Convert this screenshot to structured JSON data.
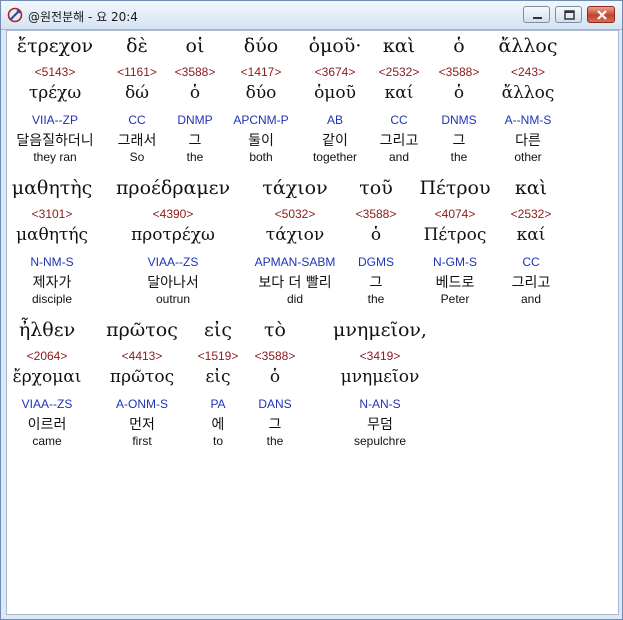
{
  "window": {
    "title": "@원전분해 - 요 20:4"
  },
  "colors": {
    "strongs": "#8b1a1a",
    "parsing": "#1f33b6",
    "text": "#111111"
  },
  "icons": {
    "app": "app-icon",
    "minimize": "minimize-icon",
    "maximize": "maximize-icon",
    "close": "close-icon"
  },
  "lines": [
    {
      "words": [
        {
          "greek": "ἔτρεχον",
          "strongs": "<5143>",
          "lemma": "τρέχω",
          "parsing": "VIIA--ZP",
          "korean": "달음질하더니",
          "english": "they ran"
        },
        {
          "greek": "δὲ",
          "strongs": "<1161>",
          "lemma": "δώ",
          "parsing": "CC",
          "korean": "그래서",
          "english": "So"
        },
        {
          "greek": "οἱ",
          "strongs": "<3588>",
          "lemma": "ὁ",
          "parsing": "DNMP",
          "korean": "그",
          "english": "the"
        },
        {
          "greek": "δύο",
          "strongs": "<1417>",
          "lemma": "δύο",
          "parsing": "APCNM-P",
          "korean": "둘이",
          "english": "both"
        },
        {
          "greek": "ὁμοῦ·",
          "strongs": "<3674>",
          "lemma": "ὁμοῦ",
          "parsing": "AB",
          "korean": "같이",
          "english": "together"
        },
        {
          "greek": "καὶ",
          "strongs": "<2532>",
          "lemma": "καί",
          "parsing": "CC",
          "korean": "그리고",
          "english": "and"
        },
        {
          "greek": "ὁ",
          "strongs": "<3588>",
          "lemma": "ὁ",
          "parsing": "DNMS",
          "korean": "그",
          "english": "the"
        },
        {
          "greek": "ἄλλος",
          "strongs": "<243>",
          "lemma": "ἄλλος",
          "parsing": "A--NM-S",
          "korean": "다른",
          "english": "other"
        }
      ]
    },
    {
      "words": [
        {
          "greek": "μαθητὴς",
          "strongs": "<3101>",
          "lemma": "μαθητής",
          "parsing": "N-NM-S",
          "korean": "제자가",
          "english": "disciple"
        },
        {
          "greek": "προέδραμεν",
          "strongs": "<4390>",
          "lemma": "προτρέχω",
          "parsing": "VIAA--ZS",
          "korean": "달아나서",
          "english": "outrun"
        },
        {
          "greek": "τάχιον",
          "strongs": "<5032>",
          "lemma": "τάχιον",
          "parsing": "APMAN-SABM",
          "korean": "보다 더 빨리",
          "english": "did"
        },
        {
          "greek": "τοῦ",
          "strongs": "<3588>",
          "lemma": "ὁ",
          "parsing": "DGMS",
          "korean": "그",
          "english": "the"
        },
        {
          "greek": "Πέτρου",
          "strongs": "<4074>",
          "lemma": "Πέτρος",
          "parsing": "N-GM-S",
          "korean": "베드로",
          "english": "Peter"
        },
        {
          "greek": "καὶ",
          "strongs": "<2532>",
          "lemma": "καί",
          "parsing": "CC",
          "korean": "그리고",
          "english": "and"
        }
      ]
    },
    {
      "words": [
        {
          "greek": "ἦλθεν",
          "strongs": "<2064>",
          "lemma": "ἔρχομαι",
          "parsing": "VIAA--ZS",
          "korean": "이르러",
          "english": "came"
        },
        {
          "greek": "πρῶτος",
          "strongs": "<4413>",
          "lemma": "πρῶτος",
          "parsing": "A-ONM-S",
          "korean": "먼저",
          "english": "first"
        },
        {
          "greek": "εἰς",
          "strongs": "<1519>",
          "lemma": "εἰς",
          "parsing": "PA",
          "korean": "에",
          "english": "to"
        },
        {
          "greek": "τὸ",
          "strongs": "<3588>",
          "lemma": "ὁ",
          "parsing": "DANS",
          "korean": "그",
          "english": "the"
        },
        {
          "greek": "μνημεῖον,",
          "strongs": "<3419>",
          "lemma": "μνημεῖον",
          "parsing": "N-AN-S",
          "korean": "무덤",
          "english": "sepulchre"
        }
      ]
    }
  ]
}
